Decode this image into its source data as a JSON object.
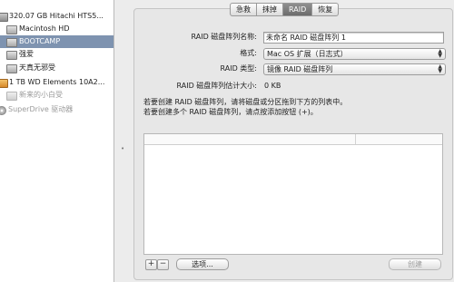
{
  "sidebar": {
    "items": [
      {
        "label": "320.07 GB Hitachi HTS5...",
        "icon": "hard-disk-icon"
      },
      {
        "label": "Macintosh HD",
        "icon": "volume-icon"
      },
      {
        "label": "BOOTCAMP",
        "icon": "volume-icon"
      },
      {
        "label": "强爱",
        "icon": "volume-icon"
      },
      {
        "label": "天真无邪受",
        "icon": "volume-icon"
      },
      {
        "label": "1 TB WD Elements 10A2...",
        "icon": "external-disk-icon"
      },
      {
        "label": "新来的小白受",
        "icon": "volume-icon"
      },
      {
        "label": "SuperDrive 驱动器",
        "icon": "optical-drive-icon"
      }
    ]
  },
  "tabs": [
    {
      "label": "急救"
    },
    {
      "label": "抹掉"
    },
    {
      "label": "RAID"
    },
    {
      "label": "恢复"
    }
  ],
  "form": {
    "name_label": "RAID 磁盘阵列名称:",
    "name_value": "未命名 RAID 磁盘阵列 1",
    "format_label": "格式:",
    "format_value": "Mac OS 扩展（日志式）",
    "type_label": "RAID 类型:",
    "type_value": "镜像 RAID 磁盘阵列",
    "size_label": "RAID 磁盘阵列估计大小:",
    "size_value": "0 KB"
  },
  "instructions": {
    "line1": "若要创建 RAID 磁盘阵列，请将磁盘或分区拖到下方的列表中。",
    "line2": "若要创建多个 RAID 磁盘阵列，请点按添加按钮 (+)。"
  },
  "buttons": {
    "add": "+",
    "remove": "−",
    "options": "选项...",
    "create": "创建"
  }
}
